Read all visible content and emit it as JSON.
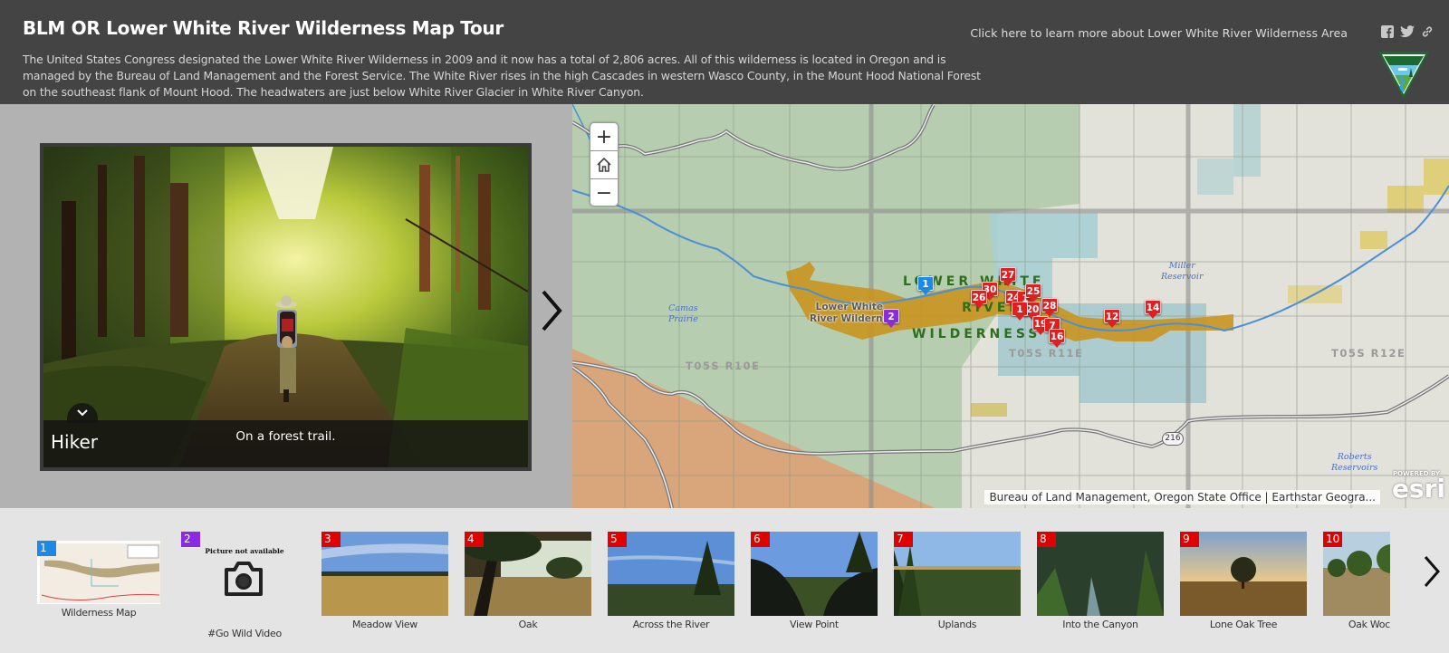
{
  "header": {
    "title": "BLM OR Lower White River Wilderness Map Tour",
    "description": "The United States Congress designated the Lower White River Wilderness in 2009 and it now has a total of 2,806 acres. All of this wilderness is located in Oregon and is managed by the Bureau of Land Management and the Forest Service. The White River rises in the high Cascades in western Wasco County, in the Mount Hood National Forest on the southeast flank of Mount Hood. The headwaters are just below White River Glacier in White River Canyon.",
    "learn_more_link": "Click here to learn more about Lower White River Wilderness Area",
    "share_icons": [
      "facebook-icon",
      "twitter-icon",
      "link-icon"
    ],
    "logo": "blm-logo"
  },
  "media": {
    "caption_title": "Hiker",
    "caption_text": "On a forest trail.",
    "collapse_icon": "chevron-down-icon",
    "next_icon": "chevron-right-icon"
  },
  "map": {
    "zoom_in": "+",
    "zoom_out": "−",
    "home_icon": "home-icon",
    "labels": {
      "wilderness_line1": "LOWER WHITE",
      "wilderness_line2": "RIVER",
      "wilderness_line3": "WILDERNESS",
      "area_line1": "Lower White",
      "area_line2": "River Wilderne",
      "twp1": "T05S  R10E",
      "twp2": "T05S  R11E",
      "twp3": "T05S  R12E",
      "camas1": "Camas",
      "camas2": "Prairie",
      "miller1": "Miller",
      "miller2": "Reservoir",
      "roberts1": "Roberts",
      "roberts2": "Reservoirs",
      "highway": "216"
    },
    "attribution": "Bureau of Land Management, Oregon State Office | Earthstar Geogra...",
    "powered_by": "POWERED BY",
    "esri": "esri",
    "markers": [
      {
        "n": "1",
        "color": "#1e88e5"
      },
      {
        "n": "2",
        "color": "#8a2be2"
      },
      {
        "n": "30",
        "color": "#e02020"
      },
      {
        "n": "27",
        "color": "#e02020"
      },
      {
        "n": "26",
        "color": "#e02020"
      },
      {
        "n": "24",
        "color": "#e02020"
      },
      {
        "n": "1",
        "color": "#e02020"
      },
      {
        "n": "25",
        "color": "#e02020"
      },
      {
        "n": "28",
        "color": "#e02020"
      },
      {
        "n": "20",
        "color": "#e02020"
      },
      {
        "n": "1",
        "color": "#e02020"
      },
      {
        "n": "19",
        "color": "#e02020"
      },
      {
        "n": "7",
        "color": "#e02020"
      },
      {
        "n": "16",
        "color": "#e02020"
      },
      {
        "n": "12",
        "color": "#e02020"
      },
      {
        "n": "14",
        "color": "#e02020"
      }
    ]
  },
  "carousel": {
    "items": [
      {
        "n": "1",
        "label": "Wilderness Map",
        "color": "#1e88e5"
      },
      {
        "n": "2",
        "label": "#Go Wild Video",
        "color": "#8a2be2",
        "placeholder": "Picture not available"
      },
      {
        "n": "3",
        "label": "Meadow View",
        "color": "#e00000"
      },
      {
        "n": "4",
        "label": "Oak",
        "color": "#e00000"
      },
      {
        "n": "5",
        "label": "Across the River",
        "color": "#e00000"
      },
      {
        "n": "6",
        "label": "View Point",
        "color": "#e00000"
      },
      {
        "n": "7",
        "label": "Uplands",
        "color": "#e00000"
      },
      {
        "n": "8",
        "label": "Into the Canyon",
        "color": "#e00000"
      },
      {
        "n": "9",
        "label": "Lone Oak Tree",
        "color": "#e00000"
      },
      {
        "n": "10",
        "label": "Oak Woc",
        "color": "#e00000"
      }
    ],
    "next_icon": "chevron-right-icon"
  }
}
